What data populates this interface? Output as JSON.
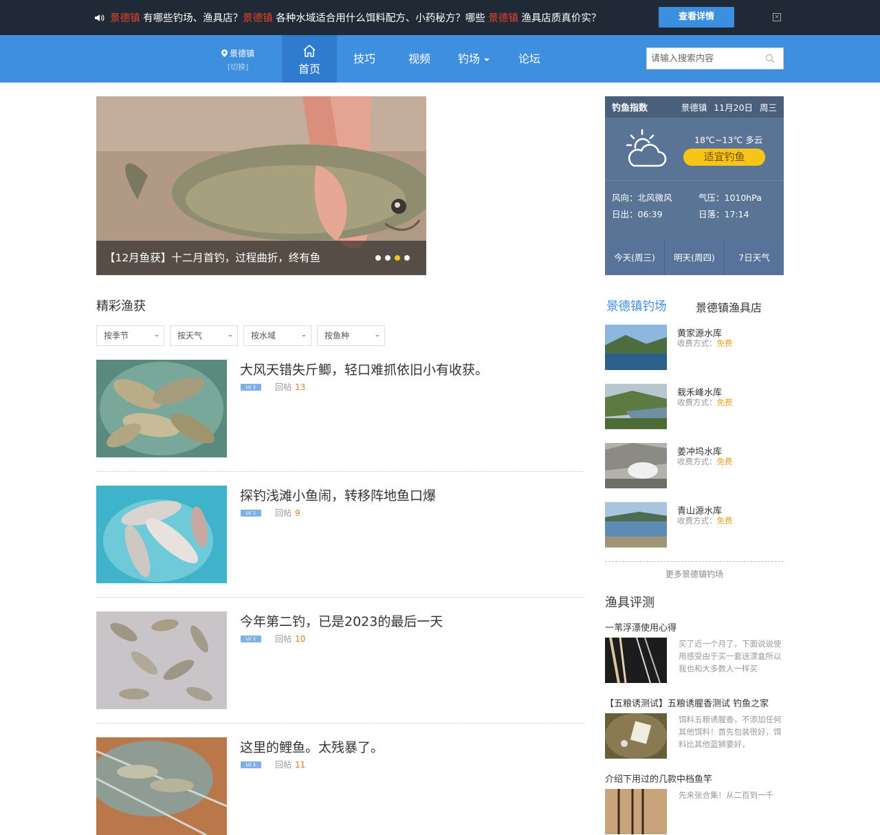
{
  "topbar": {
    "seg1": "景德镇",
    "seg2": " 有哪些钓场、渔具店？",
    "seg3": "景德镇",
    "seg4": " 各种水域适合用什么饵料配方、小药秘方？哪些 ",
    "seg5": "景德镇",
    "seg6": " 渔具店质真价实？",
    "button": "查看详情",
    "close": "×"
  },
  "nav": {
    "city": "景德镇",
    "switch": "[切换]",
    "home": "首页",
    "items": [
      "技巧",
      "视频",
      "钓场",
      "论坛"
    ],
    "search_placeholder": "请输入搜索内容"
  },
  "banner": {
    "caption": "【12月鱼获】十二月首钓，过程曲折，终有鱼",
    "dots": 4,
    "active_dot": 3
  },
  "catch": {
    "title": "精彩渔获",
    "filters": [
      "按季节",
      "按天气",
      "按水域",
      "按鱼种"
    ],
    "reply_label": "回帖",
    "level": "LV 1",
    "posts": [
      {
        "title": "大风天错失斤鲫，轻口难抓依旧小有收获。",
        "replies": "13"
      },
      {
        "title": "探钓浅滩小鱼闹，转移阵地鱼口爆",
        "replies": "9"
      },
      {
        "title": "今年第二钓，已是2023的最后一天",
        "replies": "10"
      },
      {
        "title": "这里的鲤鱼。太残暴了。",
        "replies": "11"
      }
    ]
  },
  "weather": {
    "title": "钓鱼指数",
    "header_right": "景德镇 11月20日 周三",
    "temp": "18℃~13℃ 多云",
    "badge": "适宜钓鱼",
    "wind": "风向：北风微风",
    "pressure": "气压：1010hPa",
    "sunrise": "日出：06:39",
    "sunset": "日落：17:14",
    "tabs": [
      "今天(周三)",
      "明天(周四)",
      "7日天气"
    ]
  },
  "spots": {
    "tab_active": "景德镇钓场",
    "tab_other": "景德镇渔具店",
    "fee_label": "收费方式：",
    "items": [
      {
        "name": "黄家源水库",
        "fee": "免费"
      },
      {
        "name": "栽禾峰水库",
        "fee": "免费"
      },
      {
        "name": "姜冲坞水库",
        "fee": "免费"
      },
      {
        "name": "青山源水库",
        "fee": "免费"
      }
    ],
    "more": "更多景德镇钓场"
  },
  "reviews": {
    "title": "渔具评测",
    "items": [
      {
        "heading": "一苇浮漂使用心得",
        "text": "买了近一个月了，下面说说使用感受由于买一套送漂盒所以我也和大多数人一样买"
      },
      {
        "heading": "【五粮诱测试】五粮诱腥香测试 钓鱼之家",
        "text": "饵料五粮诱腥香，不添加任何其他饵料！首先包装很好，饵料比其他蓝狮要好，"
      },
      {
        "heading": "介绍下用过的几款中档鱼竿",
        "text": "先来张合集！从二百到一千"
      }
    ]
  }
}
